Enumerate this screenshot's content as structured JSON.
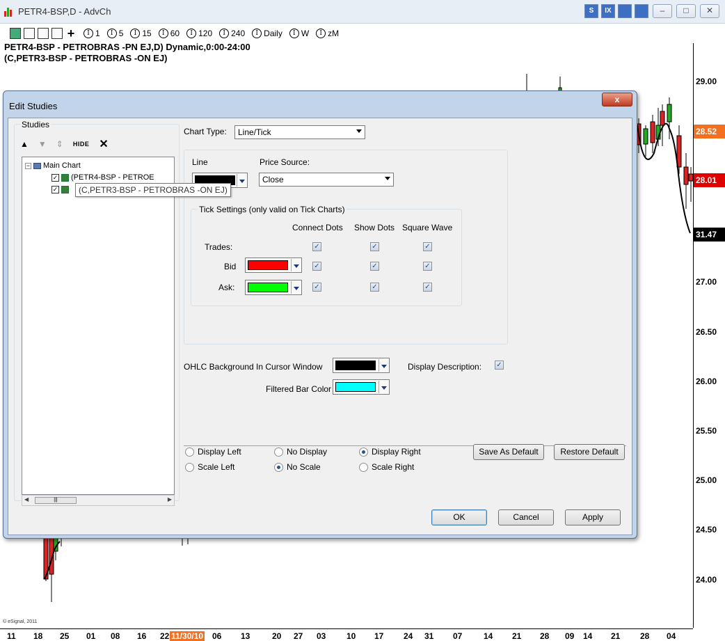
{
  "window": {
    "title": "PETR4-BSP,D - AdvCh",
    "toolbar_intervals": [
      "1",
      "5",
      "15",
      "60",
      "120",
      "240",
      "Daily",
      "W",
      "zM"
    ],
    "symbol_line1": "PETR4-BSP - PETROBRAS   -PN  EJ,D) Dynamic,0:00-24:00",
    "symbol_line2": "(C,PETR3-BSP - PETROBRAS   -ON  EJ)",
    "title_icons": [
      "S",
      "IX",
      "",
      ""
    ],
    "credit": "© eSignal, 2011"
  },
  "price_axis": {
    "labels": [
      "29.00",
      "27.00",
      "26.50",
      "26.00",
      "25.50",
      "25.00",
      "24.50",
      "24.00"
    ],
    "flags": [
      {
        "value": "28.52",
        "color": "#f37021"
      },
      {
        "value": "28.01",
        "color": "#e00000"
      },
      {
        "value": "31.47",
        "color": "#000000"
      }
    ]
  },
  "date_axis": {
    "labels": [
      "11",
      "18",
      "25",
      "01",
      "08",
      "16",
      "22",
      "11/30/10",
      "06",
      "13",
      "20",
      "27",
      "03",
      "10",
      "17",
      "24",
      "31",
      "07",
      "14",
      "21",
      "28",
      "09",
      "14",
      "21",
      "28",
      "04"
    ],
    "highlight": "11/30/10"
  },
  "dialog": {
    "title": "Edit Studies",
    "close_label": "x",
    "studies_label": "Studies",
    "hide_label": "HIDE",
    "tree": {
      "root": "Main Chart",
      "item1": "(PETR4-BSP - PETROE",
      "item2_tooltip": "(C,PETR3-BSP - PETROBRAS   -ON  EJ)"
    },
    "chart_type_label": "Chart Type:",
    "chart_type_value": "Line/Tick",
    "line_label": "Line",
    "price_source_label": "Price Source:",
    "price_source_value": "Close",
    "tick_settings_label": "Tick Settings (only valid on Tick Charts)",
    "col_connect": "Connect Dots",
    "col_show": "Show Dots",
    "col_square": "Square Wave",
    "trades_label": "Trades:",
    "bid_label": "Bid",
    "ask_label": "Ask:",
    "ohlc_label": "OHLC Background In Cursor Window",
    "filtered_label": "Filtered Bar Color",
    "display_desc_label": "Display Description:",
    "radios": {
      "display_left": "Display Left",
      "no_display": "No Display",
      "display_right": "Display Right",
      "scale_left": "Scale Left",
      "no_scale": "No Scale",
      "scale_right": "Scale Right"
    },
    "save_default": "Save As Default",
    "restore_default": "Restore Default",
    "ok": "OK",
    "cancel": "Cancel",
    "apply": "Apply",
    "colors": {
      "line": "#000000",
      "bid": "#ff0000",
      "ask": "#00ff00",
      "ohlc_bg": "#000000",
      "filtered": "#00ffff"
    }
  }
}
